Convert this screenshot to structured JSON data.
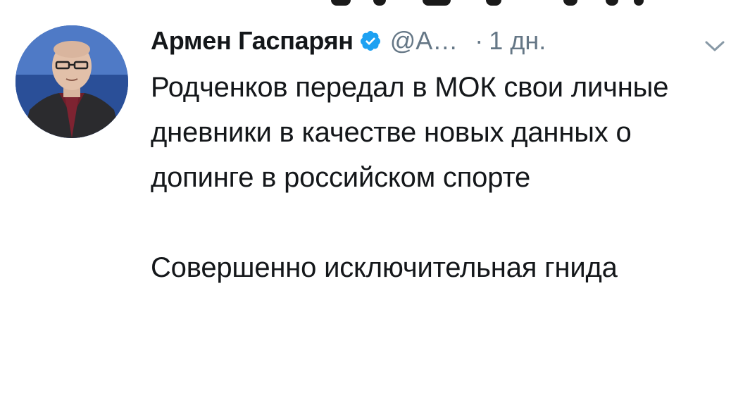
{
  "tweet": {
    "author_name": "Армен Гаспарян",
    "handle": "@А…",
    "separator": "·",
    "time": "1 дн.",
    "verified": true,
    "text_paragraph_1": "Родченков передал в МОК свои личные дневники в качестве новых данных о допинге в российском спорте",
    "text_paragraph_2": "Совершенно исключительная гнида"
  },
  "colors": {
    "text_primary": "#14171a",
    "text_secondary": "#657786",
    "verified_badge": "#1da1f2",
    "background": "#ffffff"
  },
  "icons": {
    "verified": "verified-badge-icon",
    "menu": "chevron-down-icon"
  }
}
